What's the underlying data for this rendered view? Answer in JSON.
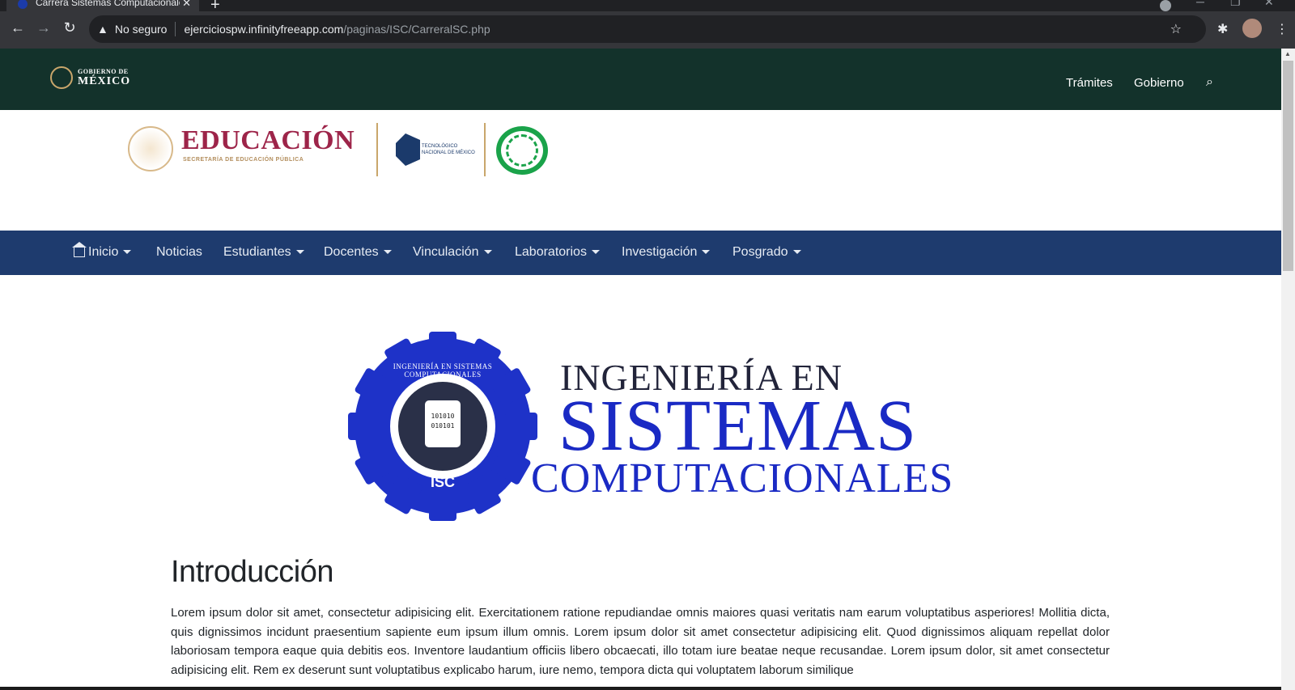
{
  "browser": {
    "tab_title": "Carrera Sistemas Computacionales",
    "tab_close": "✕",
    "new_tab": "+",
    "security_label": "No seguro",
    "url_host": "ejerciciospw.infinityfreeapp.com",
    "url_path": "/paginas/ISC/CarreralSC.php"
  },
  "gob_header": {
    "logo_line1": "GOBIERNO DE",
    "logo_line2": "MÉXICO",
    "links": [
      "Trámites",
      "Gobierno"
    ]
  },
  "logos": {
    "edu_title": "EDUCACIÓN",
    "edu_subtitle": "SECRETARÍA DE EDUCACIÓN PÚBLICA",
    "tecnm_text_1": "TECNOLÓGICO",
    "tecnm_text_2": "NACIONAL DE MÉXICO"
  },
  "nav": {
    "items": [
      {
        "label": "Inicio",
        "dropdown": true
      },
      {
        "label": "Noticias",
        "dropdown": false
      },
      {
        "label": "Estudiantes",
        "dropdown": true
      },
      {
        "label": "Docentes",
        "dropdown": true
      },
      {
        "label": "Vinculación",
        "dropdown": true
      },
      {
        "label": "Laboratorios",
        "dropdown": true
      },
      {
        "label": "Investigación",
        "dropdown": true
      },
      {
        "label": "Posgrado",
        "dropdown": true
      }
    ]
  },
  "banner": {
    "ring_text": "INGENIERÍA EN SISTEMAS COMPUTACIONALES",
    "chip_line1": "101010",
    "chip_line2": "010101",
    "badge": "ISC",
    "line1": "INGENIERÍA EN",
    "line2": "SISTEMAS",
    "line3": "COMPUTACIONALES"
  },
  "intro": {
    "title": "Introducción",
    "body": "Lorem ipsum dolor sit amet, consectetur adipisicing elit. Exercitationem ratione repudiandae omnis maiores quasi veritatis nam earum voluptatibus asperiores! Mollitia dicta, quis dignissimos incidunt praesentium sapiente eum ipsum illum omnis. Lorem ipsum dolor sit amet consectetur adipisicing elit. Quod dignissimos aliquam repellat dolor laboriosam tempora eaque quia debitis eos. Inventore laudantium officiis libero obcaecati, illo totam iure beatae neque recusandae. Lorem ipsum dolor, sit amet consectetur adipisicing elit. Rem ex deserunt sunt voluptatibus explicabo harum, iure nemo, tempora dicta qui voluptatem laborum similique"
  },
  "colors": {
    "gob_bar": "#13322b",
    "nav_bar": "#1e3b6e",
    "edu_red": "#9d2449",
    "isc_blue": "#1a2ac4"
  }
}
